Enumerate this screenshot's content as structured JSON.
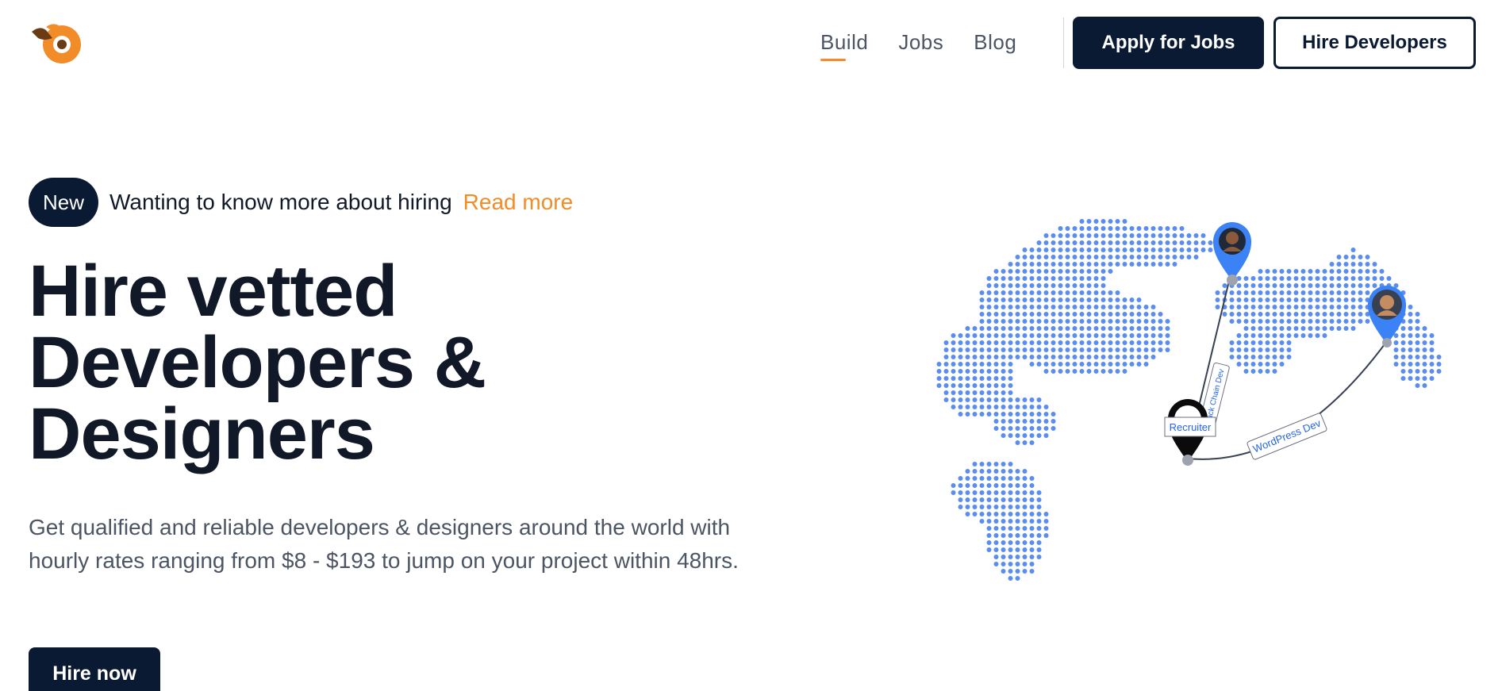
{
  "header": {
    "logo_icon": "brand-logo-icon",
    "nav": [
      {
        "label": "Build",
        "active": true
      },
      {
        "label": "Jobs",
        "active": false
      },
      {
        "label": "Blog",
        "active": false
      }
    ],
    "apply_label": "Apply for Jobs",
    "hire_dev_label": "Hire Developers"
  },
  "announcement": {
    "badge": "New",
    "text": "Wanting to know more about hiring",
    "link": "Read more"
  },
  "hero": {
    "headline_lines": [
      "Hire vetted",
      "Developers &",
      "Designers"
    ],
    "subtext": "Get qualified and reliable developers & designers around the world with hourly rates ranging from $8 - $193 to jump on your project within 48hrs.",
    "cta": "Hire now"
  },
  "map": {
    "labels": [
      "Recruiter",
      "WordPress Dev",
      "Back Chain Dev"
    ]
  },
  "colors": {
    "navy": "#0b1a33",
    "accent_orange": "#f28c28",
    "map_dots": "#5b8def"
  }
}
